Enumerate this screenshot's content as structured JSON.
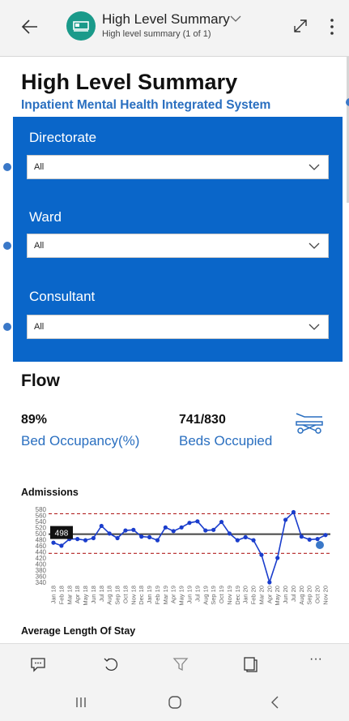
{
  "header": {
    "report_title": "High Level Summary",
    "report_subtitle": "High level summary (1 of 1)",
    "icons": [
      "back-arrow-icon",
      "hospital-bed-icon",
      "chevron-down-icon",
      "expand-icon",
      "more-vertical-icon"
    ]
  },
  "page": {
    "title": "High Level Summary",
    "subtitle": "Inpatient Mental Health Integrated System"
  },
  "filters": [
    {
      "label": "Directorate",
      "value": "All"
    },
    {
      "label": "Ward",
      "value": "All"
    },
    {
      "label": "Consultant",
      "value": "All"
    }
  ],
  "flow": {
    "title": "Flow",
    "kpis": [
      {
        "value": "89%",
        "label": "Bed Occupancy(%)"
      },
      {
        "value": "741/830",
        "label": "Beds Occupied"
      }
    ]
  },
  "admissions": {
    "title": "Admissions",
    "tooltip_value": "498"
  },
  "next_section_title": "Average Length Of Stay",
  "chart_data": {
    "type": "line",
    "title": "Admissions",
    "x": [
      "Jan 18",
      "Feb 18",
      "Mar 18",
      "Apr 18",
      "May 18",
      "Jun 18",
      "Jul 18",
      "Aug 18",
      "Sep 18",
      "Oct 18",
      "Nov 18",
      "Dec 18",
      "Jan 19",
      "Feb 19",
      "Mar 19",
      "Apr 19",
      "May 19",
      "Jun 19",
      "Jul 19",
      "Aug 19",
      "Sep 19",
      "Oct 19",
      "Nov 19",
      "Dec 19",
      "Jan 20",
      "Feb 20",
      "Mar 20",
      "Apr 20",
      "May 20",
      "Jun 20",
      "Jul 20",
      "Aug 20",
      "Sep 20",
      "Oct 20",
      "Nov 20"
    ],
    "y_ticks": [
      580,
      560,
      540,
      520,
      500,
      480,
      460,
      440,
      420,
      400,
      380,
      360,
      340
    ],
    "ylim": [
      340,
      590
    ],
    "series": [
      {
        "values": [
          470,
          460,
          482,
          482,
          478,
          485,
          525,
          500,
          485,
          510,
          512,
          490,
          488,
          478,
          520,
          508,
          520,
          535,
          540,
          510,
          512,
          538,
          500,
          478,
          488,
          478,
          430,
          340,
          420,
          545,
          570,
          490,
          480,
          482,
          495
        ]
      }
    ],
    "mean": 498,
    "upper_control_limit": 565,
    "lower_control_limit": 435,
    "colors": {
      "line": "#1a3dcc",
      "mean": "#444444",
      "limits": "#b22222"
    }
  },
  "toolbar": {
    "icons": [
      "comment-icon",
      "reset-icon",
      "filter-icon",
      "pages-icon",
      "more-horizontal-icon"
    ],
    "more_label": "···"
  },
  "system_nav": {
    "icons": [
      "recent-apps-icon",
      "home-icon",
      "system-back-icon"
    ]
  }
}
